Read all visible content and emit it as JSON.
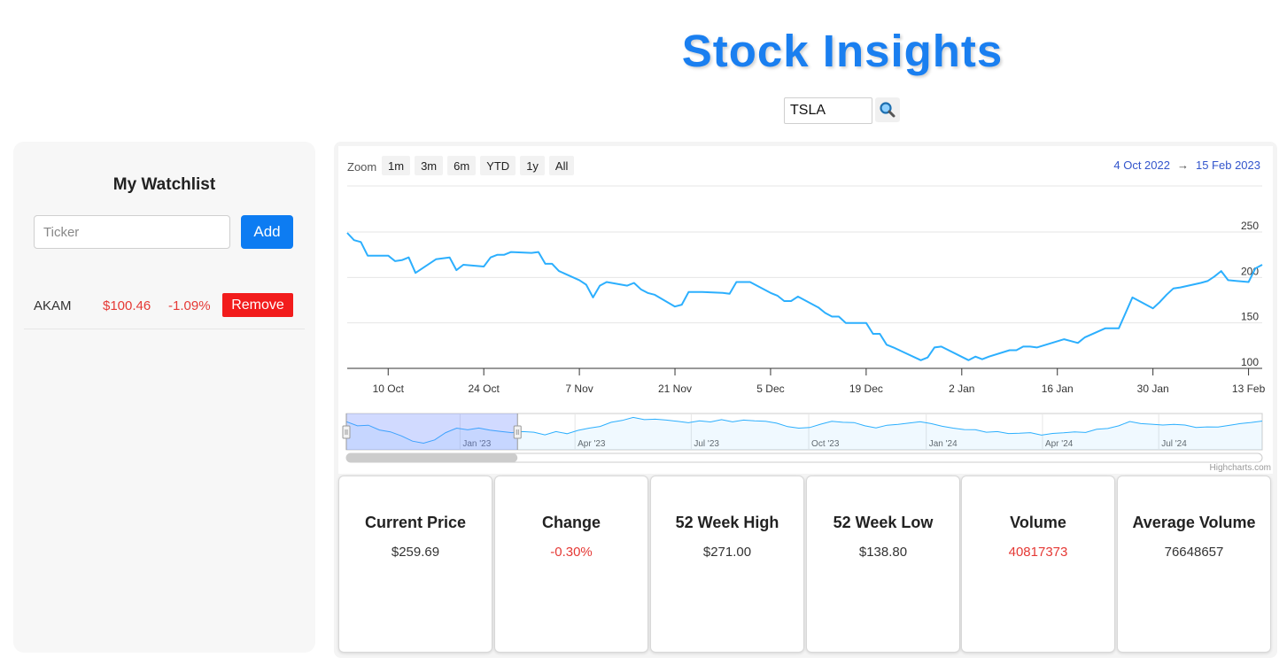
{
  "header": {
    "title": "Stock Insights",
    "search_value": "TSLA",
    "search_icon": "magnifier-icon"
  },
  "watchlist": {
    "title": "My Watchlist",
    "input_placeholder": "Ticker",
    "add_label": "Add",
    "items": [
      {
        "symbol": "AKAM",
        "price": "$100.46",
        "change": "-1.09%",
        "remove_label": "Remove"
      }
    ]
  },
  "chart_toolbar": {
    "zoom_label": "Zoom",
    "zoom_buttons": [
      "1m",
      "3m",
      "6m",
      "YTD",
      "1y",
      "All"
    ],
    "range_from": "4 Oct 2022",
    "range_arrow": "→",
    "range_to": "15 Feb 2023",
    "credit": "Highcharts.com"
  },
  "chart_data": {
    "type": "line",
    "ticker": "TSLA",
    "x": [
      "2022-10-04",
      "2022-10-05",
      "2022-10-06",
      "2022-10-07",
      "2022-10-10",
      "2022-10-11",
      "2022-10-12",
      "2022-10-13",
      "2022-10-14",
      "2022-10-17",
      "2022-10-18",
      "2022-10-19",
      "2022-10-20",
      "2022-10-21",
      "2022-10-24",
      "2022-10-25",
      "2022-10-26",
      "2022-10-27",
      "2022-10-28",
      "2022-10-31",
      "2022-11-01",
      "2022-11-02",
      "2022-11-03",
      "2022-11-04",
      "2022-11-07",
      "2022-11-08",
      "2022-11-09",
      "2022-11-10",
      "2022-11-11",
      "2022-11-14",
      "2022-11-15",
      "2022-11-16",
      "2022-11-17",
      "2022-11-18",
      "2022-11-21",
      "2022-11-22",
      "2022-11-23",
      "2022-11-25",
      "2022-11-28",
      "2022-11-29",
      "2022-11-30",
      "2022-12-01",
      "2022-12-02",
      "2022-12-05",
      "2022-12-06",
      "2022-12-07",
      "2022-12-08",
      "2022-12-09",
      "2022-12-12",
      "2022-12-13",
      "2022-12-14",
      "2022-12-15",
      "2022-12-16",
      "2022-12-19",
      "2022-12-20",
      "2022-12-21",
      "2022-12-22",
      "2022-12-23",
      "2022-12-27",
      "2022-12-28",
      "2022-12-29",
      "2022-12-30",
      "2023-01-03",
      "2023-01-04",
      "2023-01-05",
      "2023-01-06",
      "2023-01-09",
      "2023-01-10",
      "2023-01-11",
      "2023-01-12",
      "2023-01-13",
      "2023-01-17",
      "2023-01-18",
      "2023-01-19",
      "2023-01-20",
      "2023-01-23",
      "2023-01-24",
      "2023-01-25",
      "2023-01-26",
      "2023-01-27",
      "2023-01-30",
      "2023-01-31",
      "2023-02-01",
      "2023-02-02",
      "2023-02-03",
      "2023-02-06",
      "2023-02-07",
      "2023-02-08",
      "2023-02-09",
      "2023-02-10",
      "2023-02-13",
      "2023-02-14",
      "2023-02-15"
    ],
    "y": [
      249,
      241,
      239,
      224,
      224,
      218,
      219,
      222,
      205,
      220,
      221,
      222,
      208,
      214,
      212,
      222,
      225,
      225,
      228,
      227,
      228,
      215,
      215,
      207,
      197,
      192,
      178,
      191,
      195,
      191,
      194,
      187,
      183,
      181,
      168,
      170,
      184,
      184,
      183,
      182,
      195,
      195,
      195,
      183,
      180,
      174,
      174,
      179,
      167,
      161,
      157,
      157,
      150,
      150,
      138,
      138,
      126,
      123,
      109,
      112,
      123,
      124,
      109,
      113,
      110,
      113,
      120,
      120,
      124,
      124,
      123,
      132,
      130,
      128,
      134,
      144,
      144,
      144,
      161,
      178,
      166,
      173,
      181,
      188,
      189,
      194,
      196,
      201,
      207,
      197,
      195,
      210,
      214
    ],
    "xtick_labels": [
      "10 Oct",
      "24 Oct",
      "7 Nov",
      "21 Nov",
      "5 Dec",
      "19 Dec",
      "2 Jan",
      "16 Jan",
      "30 Jan",
      "13 Feb"
    ],
    "xtick_dates": [
      "2022-10-10",
      "2022-10-24",
      "2022-11-07",
      "2022-11-21",
      "2022-12-05",
      "2022-12-19",
      "2023-01-02",
      "2023-01-16",
      "2023-01-30",
      "2023-02-13"
    ],
    "yticks": [
      100,
      150,
      200,
      250
    ],
    "ylim": [
      100,
      250
    ],
    "grid": true,
    "xlabel": "",
    "ylabel": "",
    "line_color": "#2caffe",
    "navigator": {
      "labels": [
        "Jan '23",
        "Apr '23",
        "Jul '23",
        "Oct '23",
        "Jan '24",
        "Apr '24",
        "Jul '24"
      ],
      "label_dates": [
        "2023-01-01",
        "2023-04-01",
        "2023-07-01",
        "2023-10-01",
        "2024-01-01",
        "2024-04-01",
        "2024-07-01"
      ],
      "start": "2022-10-04",
      "end": "2024-09-20",
      "selected_from": "2022-10-04",
      "selected_to": "2023-02-15",
      "series": [
        249,
        222,
        226,
        195,
        183,
        157,
        123,
        110,
        131,
        178,
        207,
        196,
        208,
        194,
        186,
        178,
        185,
        181,
        164,
        185,
        171,
        193,
        207,
        218,
        245,
        257,
        276,
        262,
        265,
        259,
        251,
        242,
        254,
        247,
        262,
        248,
        259,
        254,
        251,
        239,
        217,
        207,
        211,
        233,
        251,
        245,
        243,
        222,
        209,
        226,
        231,
        240,
        249,
        236,
        219,
        207,
        198,
        197,
        181,
        185,
        172,
        174,
        178,
        162,
        173,
        177,
        183,
        179,
        200,
        205,
        222,
        250,
        236,
        232,
        227,
        231,
        227,
        211,
        215,
        214,
        225,
        236,
        244,
        253
      ]
    }
  },
  "stats": [
    {
      "label": "Current Price",
      "value": "$259.69",
      "negative": false
    },
    {
      "label": "Change",
      "value": "-0.30%",
      "negative": true
    },
    {
      "label": "52 Week High",
      "value": "$271.00",
      "negative": false
    },
    {
      "label": "52 Week Low",
      "value": "$138.80",
      "negative": false
    },
    {
      "label": "Volume",
      "value": "40817373",
      "negative": true
    },
    {
      "label": "Average Volume",
      "value": "76648657",
      "negative": false
    }
  ]
}
